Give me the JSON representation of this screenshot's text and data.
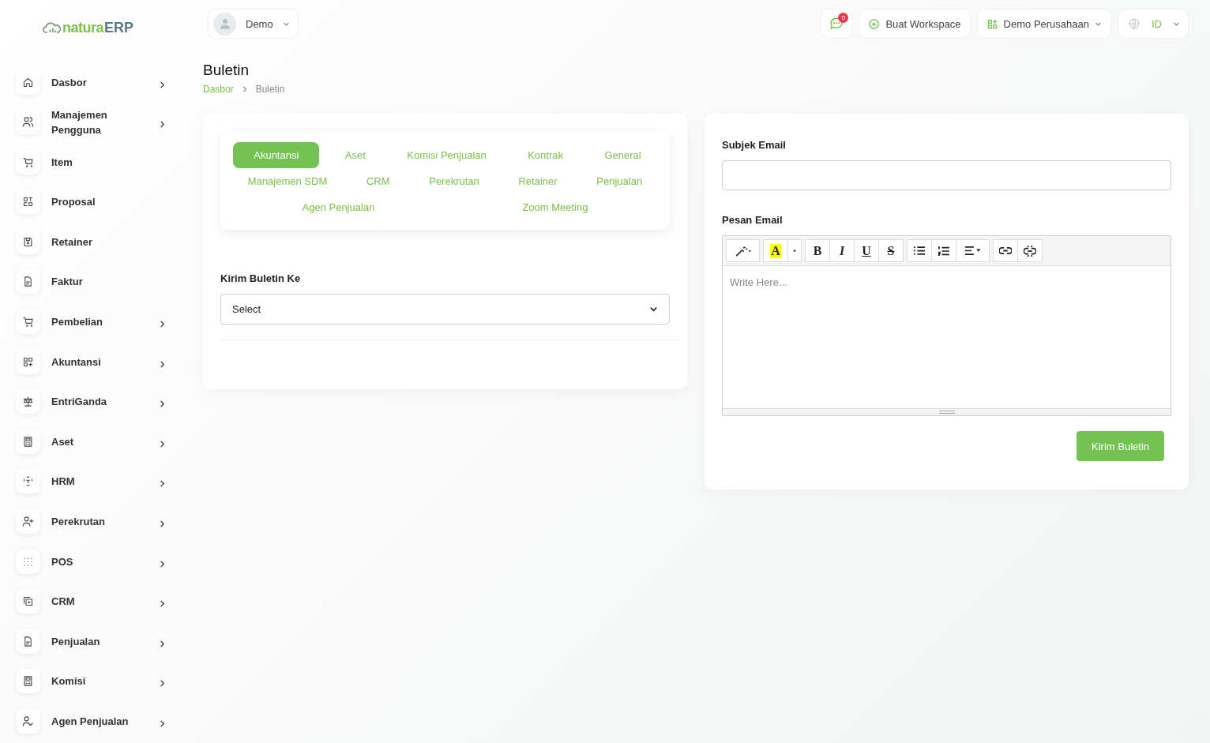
{
  "logo": {
    "part1": "natura",
    "part2": "ERP"
  },
  "header": {
    "user": "Demo",
    "notification_count": "0",
    "create_workspace": "Buat Workspace",
    "company": "Demo Perusahaan",
    "language": "ID"
  },
  "sidebar": {
    "items": [
      {
        "label": "Dasbor",
        "kind": "submenu"
      },
      {
        "label": "Manajemen Pengguna",
        "kind": "submenu"
      },
      {
        "label": "Item",
        "kind": "link"
      },
      {
        "label": "Proposal",
        "kind": "link"
      },
      {
        "label": "Retainer",
        "kind": "link"
      },
      {
        "label": "Faktur",
        "kind": "link"
      },
      {
        "label": "Pembelian",
        "kind": "submenu"
      },
      {
        "label": "Akuntansi",
        "kind": "submenu"
      },
      {
        "label": "EntriGanda",
        "kind": "submenu"
      },
      {
        "label": "Aset",
        "kind": "submenu"
      },
      {
        "label": "HRM",
        "kind": "submenu"
      },
      {
        "label": "Perekrutan",
        "kind": "submenu"
      },
      {
        "label": "POS",
        "kind": "submenu"
      },
      {
        "label": "CRM",
        "kind": "submenu"
      },
      {
        "label": "Penjualan",
        "kind": "submenu"
      },
      {
        "label": "Komisi",
        "kind": "submenu"
      },
      {
        "label": "Agen Penjualan",
        "kind": "submenu"
      }
    ]
  },
  "page": {
    "title": "Buletin",
    "breadcrumb": [
      {
        "label": "Dasbor",
        "kind": "link"
      },
      {
        "label": "Buletin",
        "kind": "current"
      }
    ]
  },
  "tabs": [
    {
      "label": "Akuntansi",
      "selected": true
    },
    {
      "label": "Aset",
      "selected": false
    },
    {
      "label": "Komisi Penjualan",
      "selected": false
    },
    {
      "label": "Kontrak",
      "selected": false
    },
    {
      "label": "General",
      "selected": false
    },
    {
      "label": "Manajemen SDM",
      "selected": false
    },
    {
      "label": "CRM",
      "selected": false
    },
    {
      "label": "Perekrutan",
      "selected": false
    },
    {
      "label": "Retainer",
      "selected": false
    },
    {
      "label": "Penjualan",
      "selected": false
    },
    {
      "label": "Agen Penjualan",
      "selected": false
    },
    {
      "label": "Zoom Meeting",
      "selected": false
    }
  ],
  "send_to": {
    "label": "Kirim Buletin Ke",
    "value": "Select"
  },
  "email": {
    "subject_label": "Subjek Email",
    "message_label": "Pesan Email",
    "placeholder": "Write Here...",
    "toolbar": [
      [
        {
          "kind": "magic"
        }
      ],
      [
        {
          "kind": "color",
          "label": "A"
        },
        {
          "kind": "caret"
        }
      ],
      [
        {
          "kind": "bold",
          "label": "B"
        },
        {
          "kind": "italic",
          "label": "I"
        },
        {
          "kind": "underline",
          "label": "U"
        },
        {
          "kind": "strike",
          "label": "S"
        }
      ],
      [
        {
          "kind": "ul"
        },
        {
          "kind": "ol"
        },
        {
          "kind": "align"
        }
      ],
      [
        {
          "kind": "link"
        },
        {
          "kind": "unlink"
        }
      ]
    ],
    "submit": "Kirim Buletin"
  }
}
